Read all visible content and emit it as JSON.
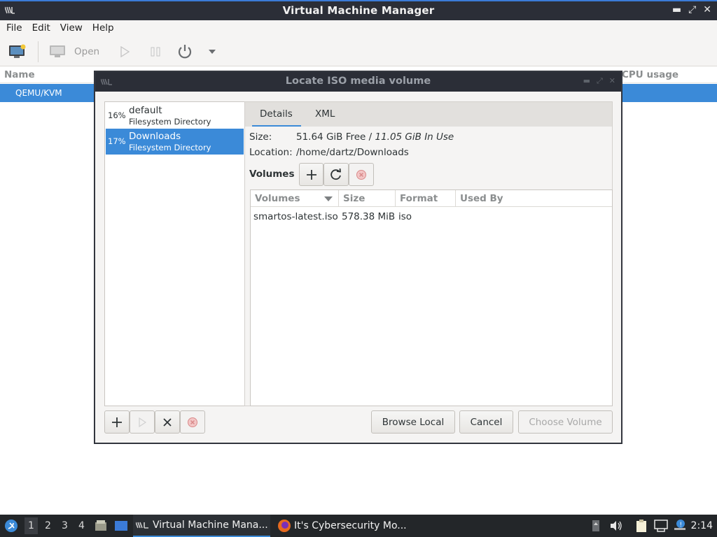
{
  "window": {
    "title": "Virtual Machine Manager"
  },
  "menu": [
    "File",
    "Edit",
    "View",
    "Help"
  ],
  "toolbar": {
    "open_label": "Open"
  },
  "list": {
    "col_name": "Name",
    "col_cpu": "CPU usage",
    "row": "QEMU/KVM"
  },
  "dialog": {
    "title": "Locate ISO media volume",
    "pools": [
      {
        "pct": "16%",
        "name": "default",
        "type": "Filesystem Directory",
        "selected": false
      },
      {
        "pct": "17%",
        "name": "Downloads",
        "type": "Filesystem Directory",
        "selected": true
      }
    ],
    "tabs": [
      "Details",
      "XML"
    ],
    "size_label": "Size:",
    "size_free": "51.64 GiB Free / ",
    "size_used": "11.05 GiB In Use",
    "location_label": "Location:",
    "location_value": "/home/dartz/Downloads",
    "volumes_label": "Volumes",
    "table": {
      "headers": [
        "Volumes",
        "Size",
        "Format",
        "Used By"
      ],
      "rows": [
        {
          "name": "smartos-latest.iso",
          "size": "578.38 MiB",
          "format": "iso",
          "used_by": ""
        }
      ]
    },
    "buttons": {
      "browse_local": "Browse Local",
      "cancel": "Cancel",
      "choose_volume": "Choose Volume"
    }
  },
  "taskbar": {
    "workspaces": [
      "1",
      "2",
      "3",
      "4"
    ],
    "tasks": [
      "Virtual Machine Mana...",
      "It's Cybersecurity Mo..."
    ],
    "clock": "2:14"
  },
  "colors": {
    "accent": "#3b8ad8",
    "titlebar": "#2b2e37",
    "taskbar": "#232629"
  }
}
